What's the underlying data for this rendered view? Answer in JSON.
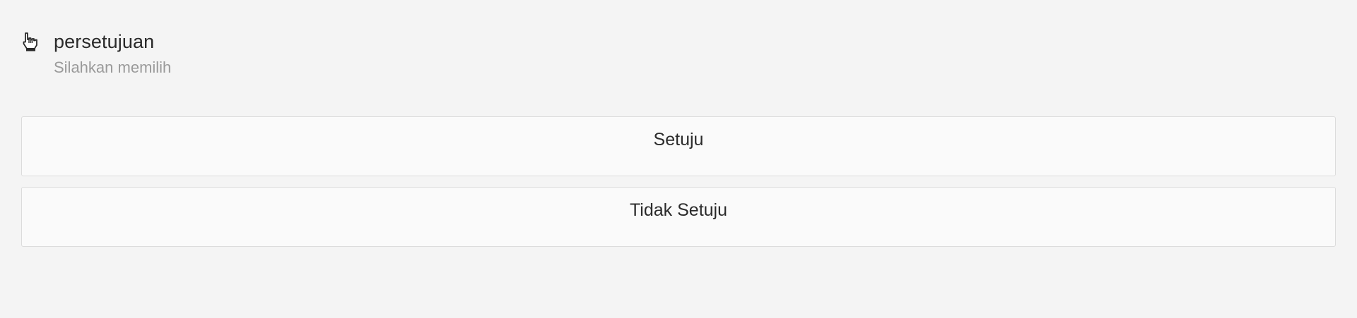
{
  "question": {
    "icon": "pointing-hand-icon",
    "title": "persetujuan",
    "subtitle": "Silahkan memilih"
  },
  "options": [
    {
      "label": "Setuju"
    },
    {
      "label": "Tidak Setuju"
    }
  ]
}
